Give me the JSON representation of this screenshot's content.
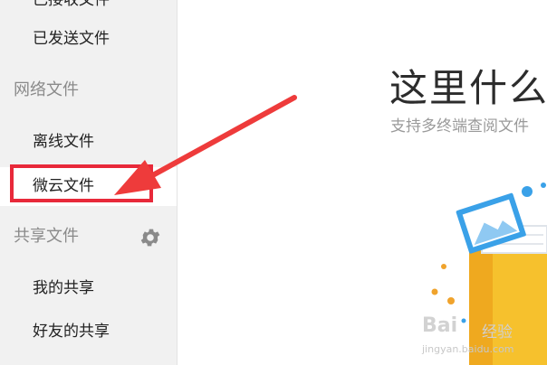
{
  "sidebar": {
    "items": [
      {
        "label": "已接收文件"
      },
      {
        "label": "已发送文件"
      },
      {
        "section": "网络文件"
      },
      {
        "label": "离线文件"
      },
      {
        "label": "微云文件"
      },
      {
        "section": "共享文件"
      },
      {
        "label": "我的共享"
      },
      {
        "label": "好友的共享"
      }
    ],
    "gear_icon": "gear-icon"
  },
  "main": {
    "title": "这里什么",
    "subtitle": "支持多终端查阅文件"
  },
  "watermark": {
    "brand": "Bai",
    "suffix": "经验",
    "url": "jingyan.baidu.com"
  },
  "colors": {
    "highlight": "#e8293a",
    "arrow": "#ee3b3b",
    "sidebar_bg": "#f1f1f1"
  }
}
